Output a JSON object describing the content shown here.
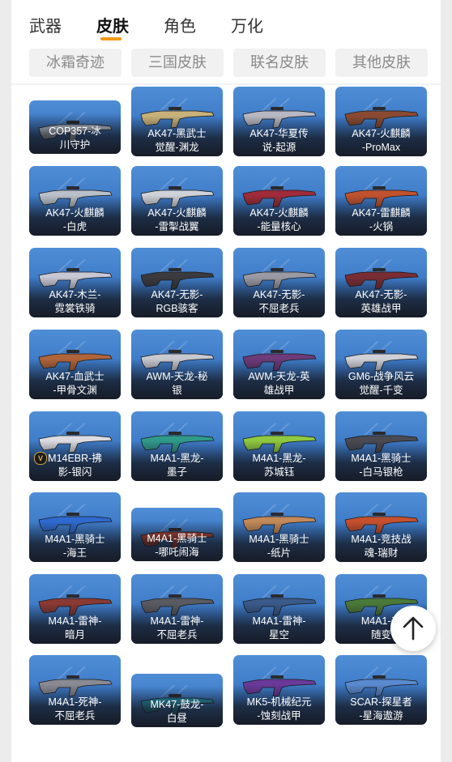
{
  "tabs": {
    "weapons": "武器",
    "skins": "皮肤",
    "roles": "角色",
    "wanhua": "万化",
    "active": "skins"
  },
  "subtabs": [
    "冰霜奇迹",
    "三国皮肤",
    "联名皮肤",
    "其他皮肤"
  ],
  "colors": {
    "accent": "#f29a14",
    "card_bg": "#3f7fcc"
  },
  "skins": [
    "COP357-冰\n川守护",
    "AK47-黑武士\n觉醒-渊龙",
    "AK47-华夏传\n说-起源",
    "AK47-火麒麟\n-ProMax",
    "AK47-火麒麟\n-白虎",
    "AK47-火麒麟\n-雷掣战翼",
    "AK47-火麒麟\n-能量核心",
    "AK47-雷麒麟\n-火锅",
    "AK47-木兰-\n霓裳铁骑",
    "AK47-无影-\nRGB骇客",
    "AK47-无影-\n不屈老兵",
    "AK47-无影-\n英雄战甲",
    "AK47-血武士\n-甲骨文渊",
    "AWM-天龙-秘\n银",
    "AWM-天龙-英\n雄战甲",
    "GM6-战争风云\n觉醒-千变",
    "M14EBR-拂\n影-银闪",
    "M4A1-黑龙-\n墨子",
    "M4A1-黑龙-\n苏城钰",
    "M4A1-黑骑士\n-白马银枪",
    "M4A1-黑骑士\n-海王",
    "M4A1-黑骑士\n-哪吒闹海",
    "M4A1-黑骑士\n-纸片",
    "M4A1-竞技战\n魂-瑞财",
    "M4A1-雷神-\n暗月",
    "M4A1-雷神-\n不屈老兵",
    "M4A1-雷神-\n星空",
    "M4A1-千\n随变",
    "M4A1-死神-\n不屈老兵",
    "MK47-鼓龙-\n白昼",
    "MK5-机械纪元\n-蚀刻战甲",
    "SCAR-探星者\n-星海遨游"
  ],
  "badges": {
    "m14ebr": "V"
  },
  "icons": {
    "back_to_top": "arrow-up-icon"
  }
}
